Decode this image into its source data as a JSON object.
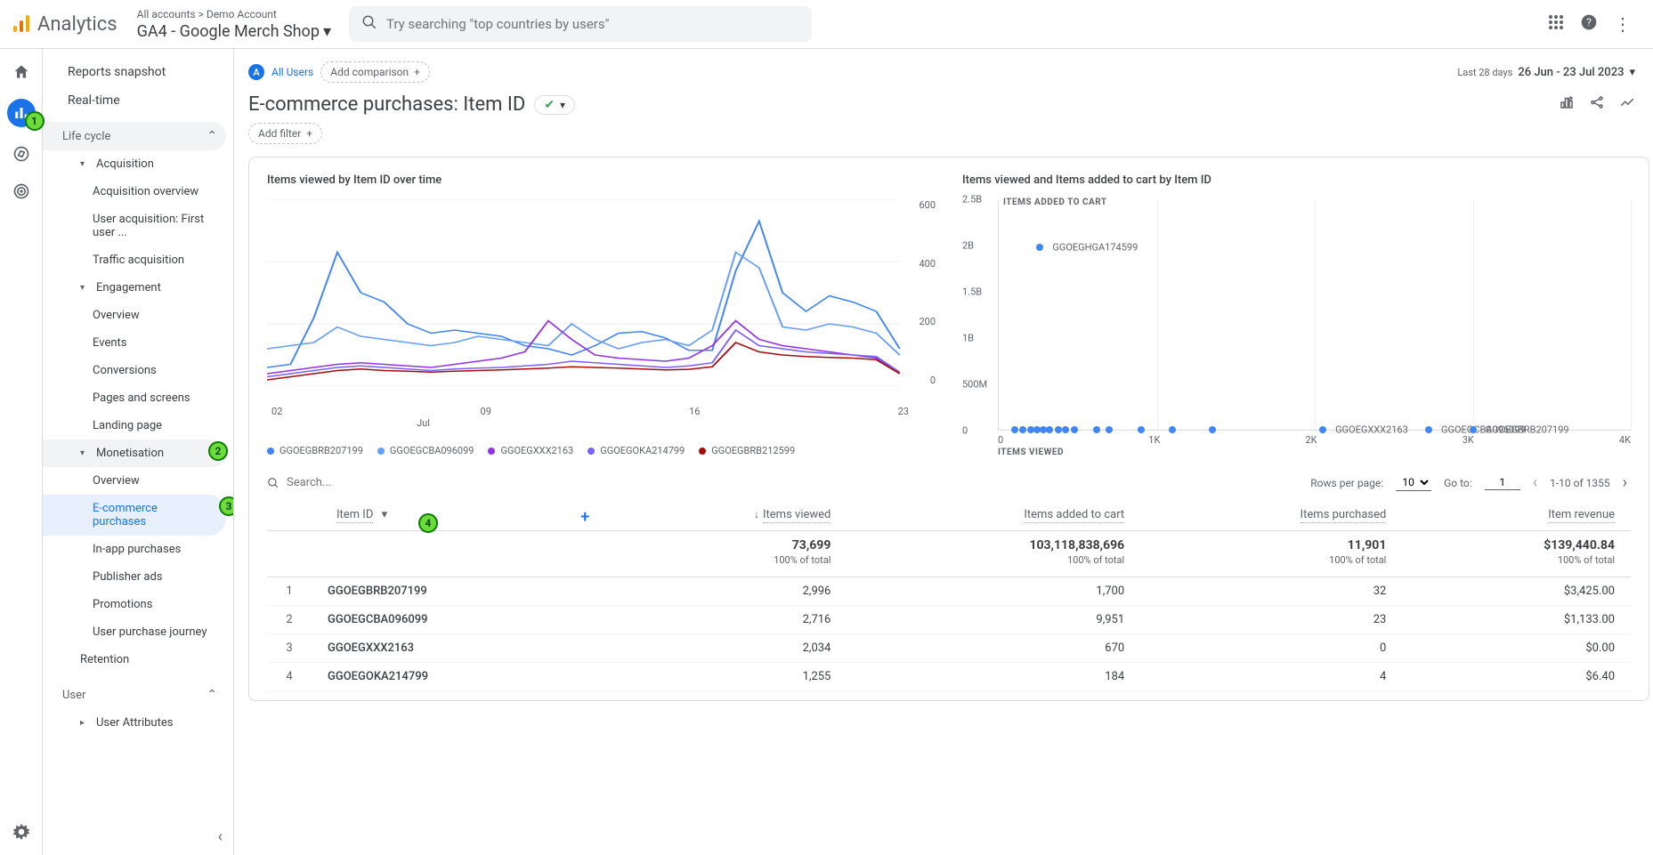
{
  "header": {
    "product": "Analytics",
    "breadcrumb": "All accounts > Demo Account",
    "property": "GA4 - Google Merch Shop",
    "search_placeholder": "Try searching \"top countries by users\""
  },
  "sidebar": {
    "snapshot": "Reports snapshot",
    "realtime": "Real-time",
    "lifecycle": "Life cycle",
    "acquisition": "Acquisition",
    "acq_overview": "Acquisition overview",
    "acq_user": "User acquisition: First user ...",
    "acq_traffic": "Traffic acquisition",
    "engagement": "Engagement",
    "eng_overview": "Overview",
    "eng_events": "Events",
    "eng_conversions": "Conversions",
    "eng_pages": "Pages and screens",
    "eng_landing": "Landing page",
    "monetisation": "Monetisation",
    "mon_overview": "Overview",
    "mon_ecom": "E-commerce purchases",
    "mon_inapp": "In-app purchases",
    "mon_publisher": "Publisher ads",
    "mon_promotions": "Promotions",
    "mon_journey": "User purchase journey",
    "retention": "Retention",
    "user": "User",
    "user_attrs": "User Attributes"
  },
  "toolbar": {
    "all_users": "All Users",
    "add_comparison": "Add comparison",
    "date_label": "Last 28 days",
    "date_value": "26 Jun - 23 Jul 2023"
  },
  "page": {
    "title": "E-commerce purchases: Item ID",
    "add_filter": "Add filter"
  },
  "charts": {
    "line_title": "Items viewed by Item ID over time",
    "scatter_title": "Items viewed and Items added to cart by Item ID",
    "scatter_ylabel": "ITEMS ADDED TO CART",
    "scatter_xlabel": "ITEMS VIEWED",
    "legend": {
      "a": "GGOEGBRB207199",
      "b": "GGOEGCBA096099",
      "c": "GGOEGXXX2163",
      "d": "GGOEGOKA214799",
      "e": "GGOEGBRB212599"
    },
    "scatter_labels": {
      "top": "GGOEGHGA174599",
      "r1": "GGOEGXXX2163",
      "r2": "GGOEGCBA096099",
      "r3": "GGOEGBRB207199"
    }
  },
  "chart_data": {
    "line": {
      "type": "line",
      "ylim": [
        0,
        600
      ],
      "yticks": [
        "600",
        "400",
        "200",
        "0"
      ],
      "xticks": [
        "02",
        "09",
        "16",
        "23"
      ],
      "xsub": "Jul",
      "series": [
        {
          "name": "GGOEGBRB207199",
          "color": "#4285f4",
          "values": [
            60,
            70,
            220,
            430,
            300,
            270,
            200,
            170,
            180,
            170,
            160,
            130,
            120,
            100,
            130,
            170,
            175,
            155,
            115,
            115,
            370,
            530,
            300,
            240,
            290,
            270,
            240,
            120
          ]
        },
        {
          "name": "GGOEGCBA096099",
          "color": "#669df6",
          "values": [
            120,
            130,
            140,
            190,
            160,
            150,
            140,
            130,
            140,
            160,
            150,
            140,
            130,
            200,
            150,
            120,
            140,
            150,
            130,
            180,
            430,
            380,
            190,
            180,
            200,
            190,
            170,
            100
          ]
        },
        {
          "name": "GGOEGXXX2163",
          "color": "#9334e6",
          "values": [
            40,
            50,
            60,
            70,
            75,
            70,
            65,
            60,
            70,
            80,
            90,
            110,
            210,
            150,
            100,
            90,
            85,
            80,
            90,
            130,
            210,
            150,
            130,
            120,
            110,
            100,
            90,
            40
          ]
        },
        {
          "name": "GGOEGOKA214799",
          "color": "#7b61ff",
          "values": [
            30,
            40,
            50,
            60,
            65,
            60,
            55,
            50,
            55,
            58,
            60,
            65,
            70,
            80,
            75,
            70,
            65,
            60,
            65,
            75,
            180,
            130,
            120,
            110,
            105,
            100,
            95,
            45
          ]
        },
        {
          "name": "GGOEGBRB212599",
          "color": "#a50e0e",
          "values": [
            20,
            30,
            40,
            50,
            55,
            50,
            48,
            45,
            48,
            50,
            52,
            55,
            58,
            62,
            60,
            58,
            55,
            52,
            54,
            62,
            140,
            110,
            100,
            95,
            92,
            90,
            85,
            40
          ]
        }
      ]
    },
    "scatter": {
      "type": "scatter",
      "xlim": [
        0,
        4000
      ],
      "xticks": [
        "0",
        "1K",
        "2K",
        "3K",
        "4K"
      ],
      "ylim": [
        0,
        2500000000
      ],
      "yticks": [
        "0",
        "500M",
        "1B",
        "1.5B",
        "2B",
        "2.5B"
      ],
      "points": [
        {
          "x": 260,
          "y": 1980000000,
          "label": "GGOEGHGA174599"
        },
        {
          "x": 100,
          "y": 0
        },
        {
          "x": 150,
          "y": 0
        },
        {
          "x": 200,
          "y": 0
        },
        {
          "x": 240,
          "y": 0
        },
        {
          "x": 280,
          "y": 0
        },
        {
          "x": 320,
          "y": 0
        },
        {
          "x": 380,
          "y": 0
        },
        {
          "x": 420,
          "y": 0
        },
        {
          "x": 480,
          "y": 0
        },
        {
          "x": 620,
          "y": 0
        },
        {
          "x": 700,
          "y": 0
        },
        {
          "x": 900,
          "y": 0
        },
        {
          "x": 1100,
          "y": 0
        },
        {
          "x": 1350,
          "y": 0
        },
        {
          "x": 2050,
          "y": 0,
          "label": "GGOEGXXX2163"
        },
        {
          "x": 2720,
          "y": 0,
          "label": "GGOEGCBA096099"
        },
        {
          "x": 3000,
          "y": 0,
          "label": "GGOEGBRB207199"
        }
      ]
    }
  },
  "table": {
    "search_placeholder": "Search...",
    "rows_per_page_label": "Rows per page:",
    "rows_per_page": "10",
    "goto_label": "Go to:",
    "goto_value": "1",
    "range": "1-10 of 1355",
    "dim_header": "Item ID",
    "cols": {
      "a": "Items viewed",
      "b": "Items added to cart",
      "c": "Items purchased",
      "d": "Item revenue"
    },
    "totals": {
      "a": "73,699",
      "a_pct": "100% of total",
      "b": "103,118,838,696",
      "b_pct": "100% of total",
      "c": "11,901",
      "c_pct": "100% of total",
      "d": "$139,440.84",
      "d_pct": "100% of total"
    },
    "rows": [
      {
        "idx": "1",
        "dim": "GGOEGBRB207199",
        "a": "2,996",
        "b": "1,700",
        "c": "32",
        "d": "$3,425.00"
      },
      {
        "idx": "2",
        "dim": "GGOEGCBA096099",
        "a": "2,716",
        "b": "9,951",
        "c": "23",
        "d": "$1,133.00"
      },
      {
        "idx": "3",
        "dim": "GGOEGXXX2163",
        "a": "2,034",
        "b": "670",
        "c": "0",
        "d": "$0.00"
      },
      {
        "idx": "4",
        "dim": "GGOEGOKA214799",
        "a": "1,255",
        "b": "184",
        "c": "4",
        "d": "$6.40"
      }
    ]
  }
}
